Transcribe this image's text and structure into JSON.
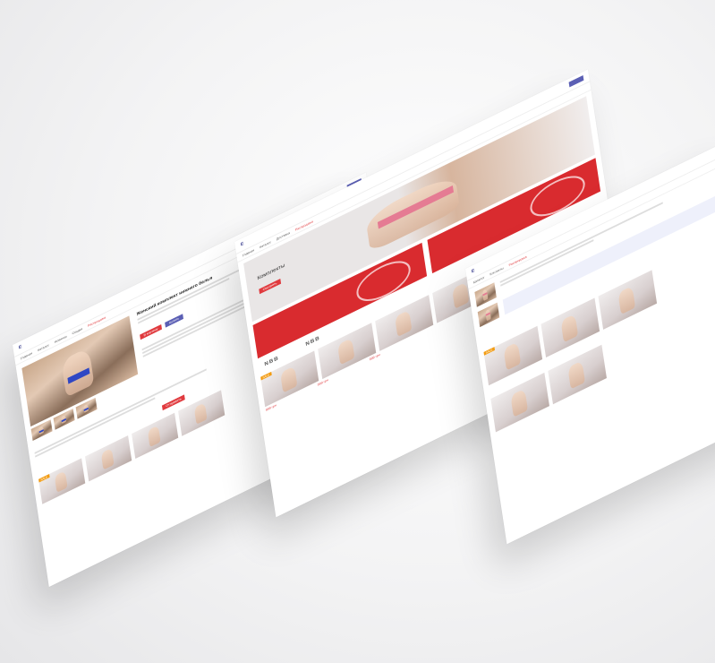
{
  "brand_mark": "E",
  "nav_items": [
    "Главная",
    "Каталог",
    "Новинки",
    "Скидки",
    "Доставка",
    "Контакты"
  ],
  "nav_hot": "Распродажа",
  "product_title": "Женский комплект нижнего белья",
  "buttons": {
    "buy": "В корзину",
    "quick": "Купить",
    "submit": "Отправить",
    "more": "Подробнее"
  },
  "hero": {
    "headline": "Комплекты",
    "cta": "Смотреть"
  },
  "brands": [
    "NBB",
    "NBB"
  ],
  "price_label": "999 грн",
  "sale_badge": "SALE",
  "colors": {
    "accent": "#e03a3e",
    "brand": "#3b3f8f",
    "button_blue": "#5b5fb4"
  }
}
